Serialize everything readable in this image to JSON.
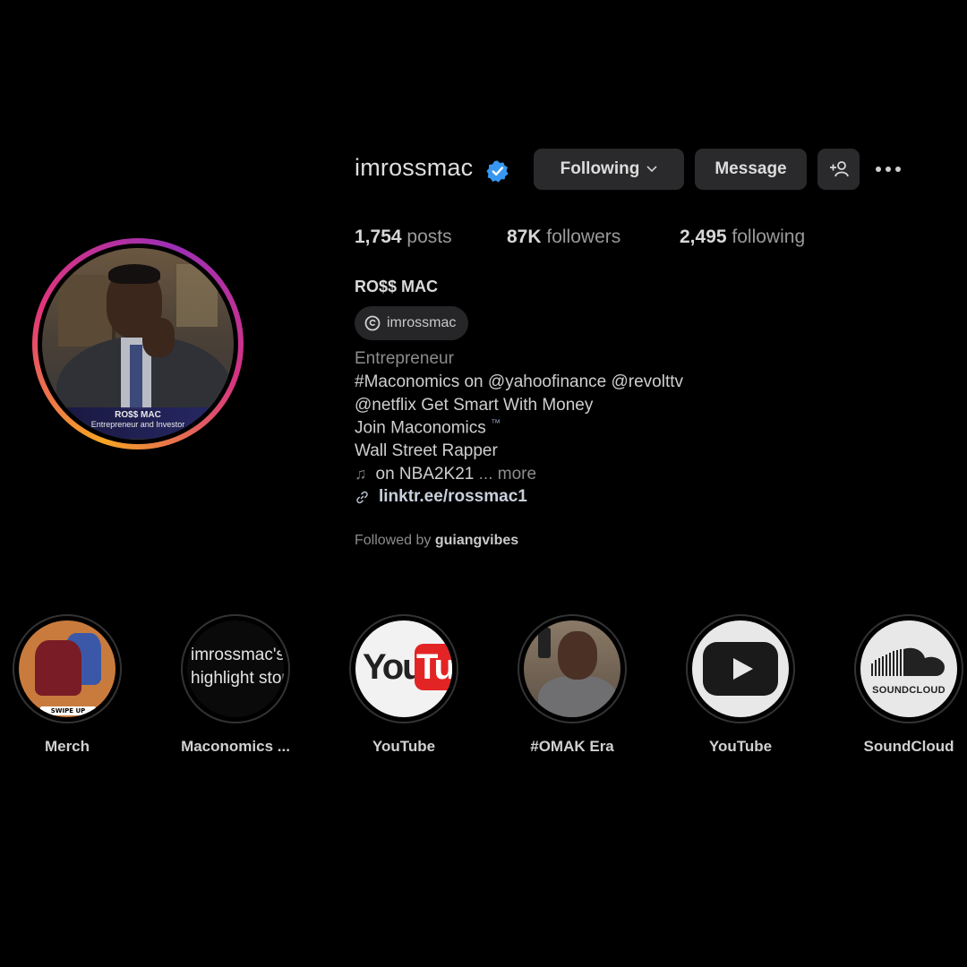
{
  "profile": {
    "username": "imrossmac",
    "verified": true,
    "buttons": {
      "following": "Following",
      "message": "Message"
    },
    "stats": {
      "posts_count": "1,754",
      "posts_label": "posts",
      "followers_count": "87K",
      "followers_label": "followers",
      "following_count": "2,495",
      "following_label": "following"
    },
    "full_name": "RO$$ MAC",
    "threads_handle": "imrossmac",
    "category": "Entrepreneur",
    "bio_lines": [
      "#Maconomics on @yahoofinance @revolttv",
      "@netflix Get Smart With Money",
      "Join Maconomics",
      "Wall Street Rapper",
      "on NBA2K21"
    ],
    "bio_trademark": "™",
    "bio_more": "... more",
    "link": "linktr.ee/rossmac1",
    "followed_by_prefix": "Followed by",
    "followed_by_user": "guiangvibes",
    "avatar_banner": {
      "name": "RO$$ MAC",
      "title": "Entrepreneur and Investor"
    }
  },
  "highlights": [
    {
      "label": "Merch",
      "cover_text": "SWIPE UP"
    },
    {
      "label": "Maconomics ...",
      "cover_text": "imrossmac's highlight story"
    },
    {
      "label": "YouTube",
      "cover_text": "YouTube"
    },
    {
      "label": "#OMAK Era",
      "cover_text": ""
    },
    {
      "label": "YouTube",
      "cover_text": ""
    },
    {
      "label": "SoundCloud",
      "cover_text": "SOUNDCLOUD"
    }
  ],
  "colors": {
    "background": "#000000",
    "button_bg": "#2a2a2c",
    "verified_blue": "#3897f0",
    "story_ring_start": "#f5a623",
    "story_ring_end": "#9b2fb5"
  }
}
